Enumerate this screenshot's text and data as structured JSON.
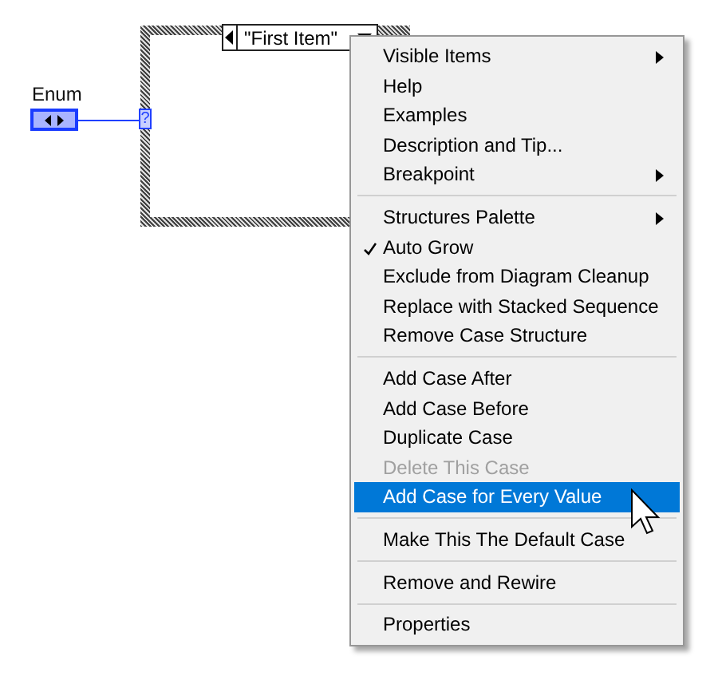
{
  "diagram": {
    "enum_label": "Enum",
    "case_selector": {
      "value": "\"First Item\""
    },
    "selector_terminal": "?"
  },
  "context_menu": {
    "sections": [
      [
        {
          "label": "Visible Items",
          "submenu": true,
          "checked": false,
          "disabled": false,
          "selected": false
        },
        {
          "label": "Help",
          "submenu": false,
          "checked": false,
          "disabled": false,
          "selected": false
        },
        {
          "label": "Examples",
          "submenu": false,
          "checked": false,
          "disabled": false,
          "selected": false
        },
        {
          "label": "Description and Tip...",
          "submenu": false,
          "checked": false,
          "disabled": false,
          "selected": false
        },
        {
          "label": "Breakpoint",
          "submenu": true,
          "checked": false,
          "disabled": false,
          "selected": false
        }
      ],
      [
        {
          "label": "Structures Palette",
          "submenu": true,
          "checked": false,
          "disabled": false,
          "selected": false
        },
        {
          "label": "Auto Grow",
          "submenu": false,
          "checked": true,
          "disabled": false,
          "selected": false
        },
        {
          "label": "Exclude from Diagram Cleanup",
          "submenu": false,
          "checked": false,
          "disabled": false,
          "selected": false
        },
        {
          "label": "Replace with Stacked Sequence",
          "submenu": false,
          "checked": false,
          "disabled": false,
          "selected": false
        },
        {
          "label": "Remove Case Structure",
          "submenu": false,
          "checked": false,
          "disabled": false,
          "selected": false
        }
      ],
      [
        {
          "label": "Add Case After",
          "submenu": false,
          "checked": false,
          "disabled": false,
          "selected": false
        },
        {
          "label": "Add Case Before",
          "submenu": false,
          "checked": false,
          "disabled": false,
          "selected": false
        },
        {
          "label": "Duplicate Case",
          "submenu": false,
          "checked": false,
          "disabled": false,
          "selected": false
        },
        {
          "label": "Delete This Case",
          "submenu": false,
          "checked": false,
          "disabled": true,
          "selected": false
        },
        {
          "label": "Add Case for Every Value",
          "submenu": false,
          "checked": false,
          "disabled": false,
          "selected": true
        }
      ],
      [
        {
          "label": "Make This The Default Case",
          "submenu": false,
          "checked": false,
          "disabled": false,
          "selected": false
        }
      ],
      [
        {
          "label": "Remove and Rewire",
          "submenu": false,
          "checked": false,
          "disabled": false,
          "selected": false
        }
      ],
      [
        {
          "label": "Properties",
          "submenu": false,
          "checked": false,
          "disabled": false,
          "selected": false
        }
      ]
    ]
  }
}
